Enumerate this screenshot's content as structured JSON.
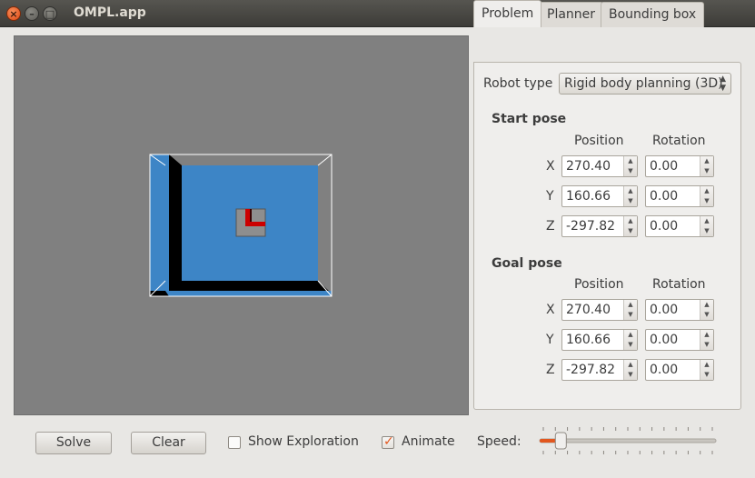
{
  "window": {
    "title": "OMPL.app"
  },
  "tabs": [
    {
      "label": "Problem",
      "active": true
    },
    {
      "label": "Planner",
      "active": false
    },
    {
      "label": "Bounding box",
      "active": false
    }
  ],
  "problem": {
    "robot_type_label": "Robot type",
    "robot_type_value": "Rigid body planning (3D)",
    "start": {
      "title": "Start pose",
      "position_header": "Position",
      "rotation_header": "Rotation",
      "rows": [
        {
          "axis": "X",
          "position": "270.40",
          "rotation": "0.00"
        },
        {
          "axis": "Y",
          "position": "160.66",
          "rotation": "0.00"
        },
        {
          "axis": "Z",
          "position": "-297.82",
          "rotation": "0.00"
        }
      ]
    },
    "goal": {
      "title": "Goal pose",
      "position_header": "Position",
      "rotation_header": "Rotation",
      "rows": [
        {
          "axis": "X",
          "position": "270.40",
          "rotation": "0.00"
        },
        {
          "axis": "Y",
          "position": "160.66",
          "rotation": "0.00"
        },
        {
          "axis": "Z",
          "position": "-297.82",
          "rotation": "0.00"
        }
      ]
    }
  },
  "controls": {
    "solve_label": "Solve",
    "clear_label": "Clear",
    "show_exploration_label": "Show Exploration",
    "show_exploration_checked": false,
    "animate_label": "Animate",
    "animate_checked": true,
    "speed_label": "Speed:",
    "speed_fraction": 0.12
  },
  "colors": {
    "environment": "#3d85c6",
    "robot": "#cc0000",
    "accent": "#e2571e",
    "viewport_bg": "#808080"
  }
}
